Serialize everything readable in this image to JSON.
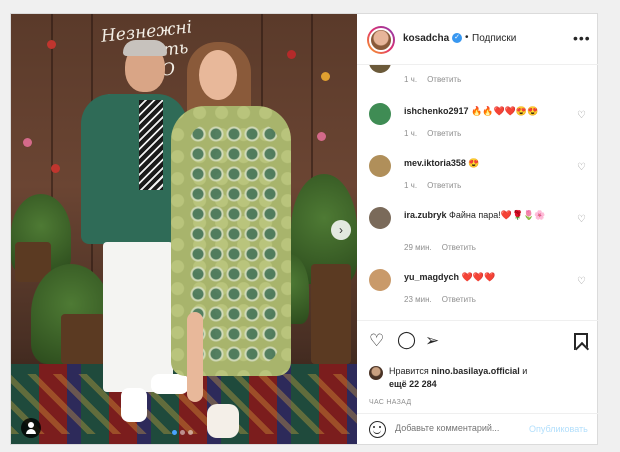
{
  "post": {
    "sign_text_line1": "Незнежні",
    "sign_text_line2": "ть",
    "sign_text_line3": "Ю",
    "carousel_dots": 3,
    "active_dot": 1
  },
  "header": {
    "username": "kosadcha",
    "separator": "•",
    "follow_label": "Подписки",
    "more_label": "•••"
  },
  "comments": [
    {
      "user": "",
      "text": "",
      "time": "1 ч.",
      "reply": "Ответить",
      "avatar_color": "#6b5a3a"
    },
    {
      "user": "ishchenko2917",
      "text": "🔥🔥❤️❤️😍😍",
      "time": "1 ч.",
      "reply": "Ответить",
      "avatar_color": "#3f8c54"
    },
    {
      "user": "mev.iktoria358",
      "text": "😍",
      "time": "1 ч.",
      "reply": "Ответить",
      "avatar_color": "#b08f5a"
    },
    {
      "user": "ira.zubryk",
      "text": "Файна пара!❤️🌹🌷🌸",
      "time": "29 мин.",
      "reply": "Ответить",
      "avatar_color": "#7a6a5a"
    },
    {
      "user": "yu_magdych",
      "text": "❤️❤️❤️",
      "time": "23 мин.",
      "reply": "Ответить",
      "avatar_color": "#c99a6a"
    }
  ],
  "actions": {
    "like_icon": "heart-icon",
    "comment_icon": "comment-icon",
    "share_icon": "share-icon",
    "save_icon": "bookmark-icon"
  },
  "likes": {
    "prefix": "Нравится ",
    "user": "nino.basilaya.official",
    "mid": " и",
    "others": "ещё 22 284"
  },
  "timestamp": "ЧАС НАЗАД",
  "add_comment": {
    "placeholder": "Добавьте комментарий...",
    "publish_label": "Опубликовать"
  },
  "colors": {
    "verified": "#3897f0",
    "publish_disabled": "#b2dffc",
    "dot_active": "#4aa3ff"
  }
}
